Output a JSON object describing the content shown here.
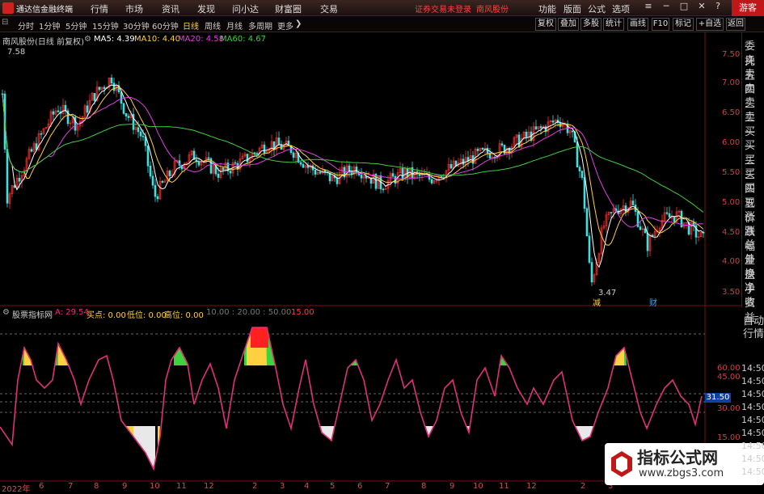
{
  "menubar": {
    "app_name": "通达信金融终端",
    "items": [
      "行情",
      "市场",
      "资讯",
      "发现",
      "问小达",
      "财富圈",
      "交易"
    ],
    "notice": "证券交易未登录",
    "stock": "南风股份",
    "right_items": [
      "功能",
      "版面",
      "公式",
      "选项"
    ],
    "guest": "游客"
  },
  "toolbar": {
    "periods": [
      "分时",
      "1分钟",
      "5分钟",
      "15分钟",
      "30分钟",
      "60分钟",
      "日线",
      "周线",
      "月线",
      "多周期",
      "更多"
    ],
    "active_period": "日线",
    "right_buttons": [
      "复权",
      "叠加",
      "多股",
      "统计",
      "画线",
      "F10",
      "标记",
      "+自选",
      "返回"
    ]
  },
  "main_legend": {
    "title": "南风股份(日线 前复权)",
    "ma5": "MA5: 4.39",
    "ma10": "MA10: 4.40",
    "ma20": "MA20: 4.58",
    "ma60": "MA60: 4.67"
  },
  "price_axis": [
    "7.50",
    "7.00",
    "6.50",
    "6.00",
    "5.50",
    "5.00",
    "4.50",
    "4.00",
    "3.50"
  ],
  "price_annotations": {
    "high": "7.58",
    "low": "3.47",
    "mark1": "减",
    "mark2": "财"
  },
  "sub_legend": {
    "title": "股票指标网",
    "a": "A: 29.54",
    "buy": "买点: 0.00",
    "low": "低位: 0.00",
    "high": "高位: 0.00",
    "levels": "10.00 : 20.00 : 50.00",
    "level15": "15.00"
  },
  "sub_axis": [
    "60.00",
    "45.00",
    "30.00",
    "15.00"
  ],
  "current_value": "31.50",
  "side_labels": [
    "委托",
    "卖五",
    "卖四",
    "卖三",
    "卖二",
    "卖一",
    "买一",
    "买二",
    "买三",
    "买四",
    "买五",
    "现价",
    "涨跌",
    "涨幅",
    "总量",
    "外盘",
    "换手",
    "净资",
    "收益"
  ],
  "side_labels2": [
    "自动",
    "行情"
  ],
  "times": [
    "14:50",
    "14:50",
    "14:50",
    "14:50",
    "14:50",
    "14:50",
    "14:50",
    "14:50",
    "14:50"
  ],
  "date_labels": [
    "2022年",
    "6",
    "7",
    "8",
    "9",
    "10",
    "11",
    "12",
    "2",
    "3",
    "4",
    "5",
    "6",
    "7",
    "8",
    "9",
    "10",
    "11",
    "12",
    "2",
    "3"
  ],
  "watermark": {
    "title": "指标公式网",
    "url": "www.zbgs3.com"
  },
  "colors": {
    "ma5": "#ffffff",
    "ma10": "#ffd040",
    "ma20": "#e040e0",
    "ma60": "#40d040",
    "up": "#ff3030",
    "down": "#40e0e0",
    "indicator": "#e0307a",
    "accent": "#c01818"
  }
}
